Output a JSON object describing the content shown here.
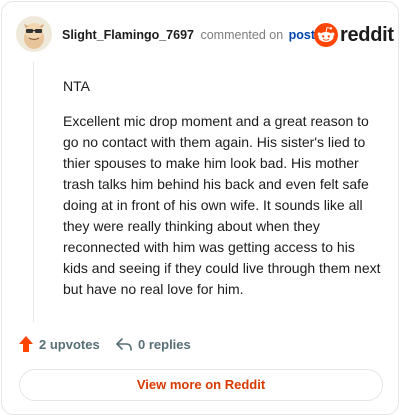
{
  "comment": {
    "username": "Slight_Flamingo_7697",
    "action_text": "commented on",
    "post_link_label": "post",
    "paragraphs": [
      "NTA",
      "Excellent mic drop moment and a great reason to go no contact with them again. His sister's lied to thier spouses to make him look bad. His mother trash talks him behind his back and even felt safe doing at in front of his own wife. It sounds like all they were really thinking about when they reconnected with him was getting access to his kids and seeing if they could live through them next but have no real love for him."
    ],
    "upvotes_label": "2 upvotes",
    "replies_label": "0 replies"
  },
  "brand": {
    "wordmark": "reddit",
    "accent_color": "#ff4500",
    "upvote_color": "#ff4500"
  },
  "cta": {
    "view_more_label": "View more on Reddit"
  },
  "icons": {
    "avatar": "snoo-avatar",
    "logo": "reddit-snoo-icon",
    "upvote": "upvote-arrow-icon",
    "reply": "reply-arrow-icon"
  }
}
